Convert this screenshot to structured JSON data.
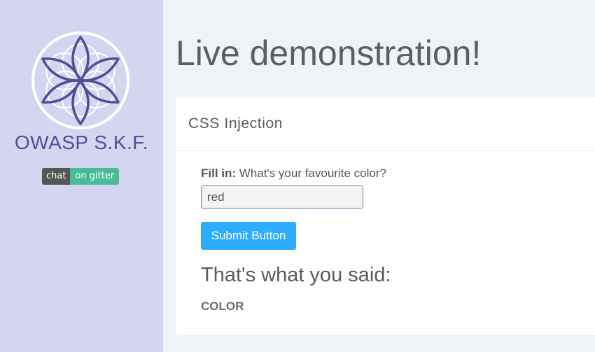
{
  "sidebar": {
    "brand": "OWASP S.K.F.",
    "badge": {
      "left": "chat",
      "right": "on gitter"
    },
    "logo_icon": "flower-of-life-icon"
  },
  "main": {
    "title": "Live demonstration!",
    "card": {
      "header": "CSS Injection",
      "fill_label_bold": "Fill in:",
      "fill_label_text": "What's your favourite color?",
      "input_value": "red",
      "submit_label": "Submit Button",
      "result_heading": "That's what you said:",
      "result_value": "COLOR"
    }
  },
  "colors": {
    "sidebar_bg": "#d4d5ee",
    "brand": "#4e4f98",
    "page_bg": "#eff2f6",
    "button": "#2eacff",
    "badge_right": "#46bc99"
  }
}
